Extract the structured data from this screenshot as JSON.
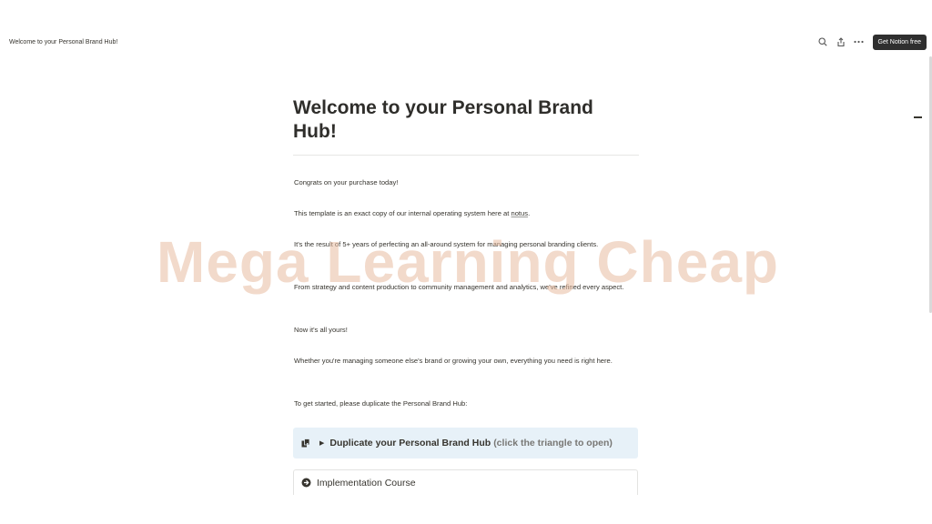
{
  "topbar": {
    "breadcrumb": "Welcome to your Personal Brand Hub!",
    "icons": [
      "search-icon",
      "share-icon",
      "more-icon"
    ],
    "cta_label": "Get Notion free"
  },
  "page": {
    "title": "Welcome to your Personal Brand Hub!",
    "paragraphs": {
      "p1": "Congrats on your purchase today!",
      "p2_before": "This template is an exact copy of our internal operating system here at ",
      "p2_link": "notus",
      "p2_after": ".",
      "p3": "It's the result of 5+ years of perfecting an all-around system for managing personal branding clients.",
      "p4": "From strategy and content production to community management and analytics, we've refined every aspect.",
      "p5": "Now it's all yours!",
      "p6": "Whether you're managing someone else's brand or growing your own, everything you need is right here.",
      "p7": "To get started, please duplicate the Personal Brand Hub:"
    },
    "callout": {
      "icon": "duplicate-icon",
      "label": "Duplicate your Personal Brand Hub",
      "hint": "(click the triangle to open)",
      "bg_color": "#e7f1f8"
    },
    "course": {
      "icon": "arrow-circle-icon",
      "label": "Implementation Course"
    }
  },
  "watermark": "Mega Learning Cheap"
}
